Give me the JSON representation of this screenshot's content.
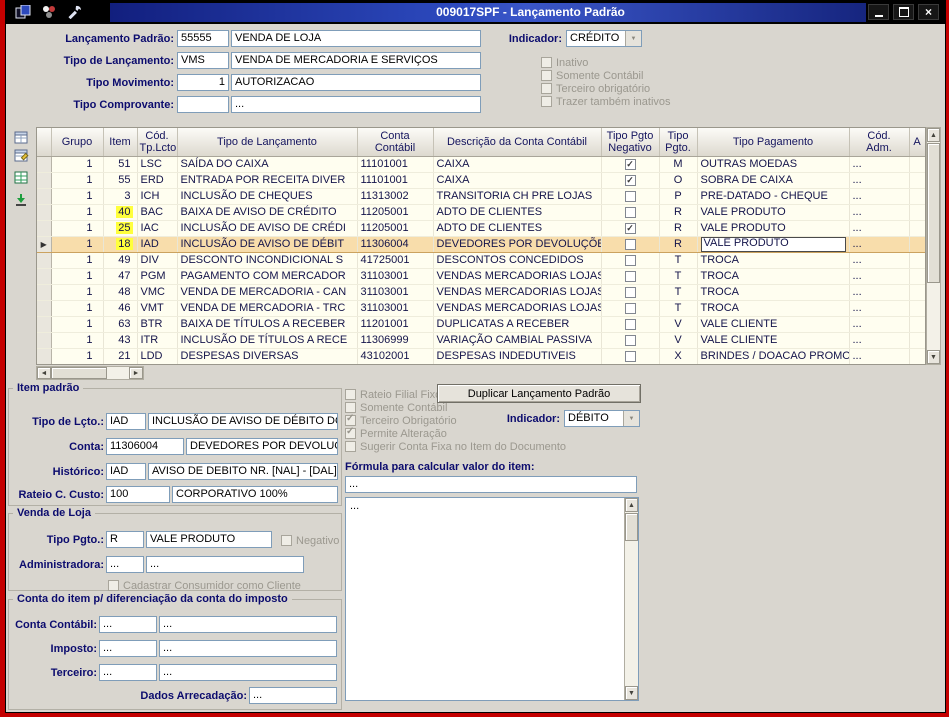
{
  "icons": {
    "dropdown": "▼",
    "check": "✓",
    "up": "▲",
    "down": "▼",
    "left": "◄",
    "right": "►",
    "row_pointer": "▶",
    "close": "×",
    "ellipsis": "..."
  },
  "window": {
    "title": "009017SPF - Lançamento Padrão"
  },
  "form": {
    "lancamento_padrao_label": "Lançamento Padrão:",
    "lancamento_padrao_code": "55555",
    "lancamento_padrao_desc": "VENDA DE LOJA",
    "indicador_label": "Indicador:",
    "indicador_value": "CRÉDITO",
    "tipo_lancamento_label": "Tipo de Lançamento:",
    "tipo_lancamento_code": "VMS",
    "tipo_lancamento_desc": "VENDA DE MERCADORIA E SERVIÇOS",
    "tipo_movimento_label": "Tipo Movimento:",
    "tipo_movimento_code": "1",
    "tipo_movimento_desc": "AUTORIZACAO",
    "tipo_comprovante_label": "Tipo Comprovante:",
    "tipo_comprovante_code": "",
    "tipo_comprovante_desc": "...",
    "options": [
      {
        "label": "Inativo",
        "checked": false
      },
      {
        "label": "Somente Contábil",
        "checked": false
      },
      {
        "label": "Terceiro obrigatório",
        "checked": false
      },
      {
        "label": "Trazer também inativos",
        "checked": false
      }
    ]
  },
  "grid": {
    "columns": [
      "",
      "Grupo",
      "Item",
      "Cód.\nTp.Lcto",
      "Tipo de Lançamento",
      "Conta Contábil",
      "Descrição da Conta Contábil",
      "Tipo Pgto\nNegativo",
      "Tipo\nPgto.",
      "Tipo Pagamento",
      "Cód.\nAdm.",
      "A"
    ],
    "rows": [
      {
        "grupo": "1",
        "item": "51",
        "cod": "LSC",
        "tipo": "SAÍDA DO CAIXA",
        "conta": "11101001",
        "descricao": "CAIXA",
        "negativo": true,
        "pgto": "M",
        "pagamento": "OUTRAS MOEDAS",
        "adm": "...",
        "item_hl": false,
        "selected": false
      },
      {
        "grupo": "1",
        "item": "55",
        "cod": "ERD",
        "tipo": "ENTRADA POR RECEITA DIVER",
        "conta": "11101001",
        "descricao": "CAIXA",
        "negativo": true,
        "pgto": "O",
        "pagamento": "SOBRA DE CAIXA",
        "adm": "...",
        "item_hl": false,
        "selected": false
      },
      {
        "grupo": "1",
        "item": "3",
        "cod": "ICH",
        "tipo": "INCLUSÃO DE CHEQUES",
        "conta": "11313002",
        "descricao": "TRANSITORIA CH PRE LOJAS",
        "negativo": false,
        "pgto": "P",
        "pagamento": "PRE-DATADO - CHEQUE",
        "adm": "...",
        "item_hl": false,
        "selected": false
      },
      {
        "grupo": "1",
        "item": "40",
        "cod": "BAC",
        "tipo": "BAIXA DE AVISO DE CRÉDITO",
        "conta": "11205001",
        "descricao": "ADTO DE CLIENTES",
        "negativo": false,
        "pgto": "R",
        "pagamento": "VALE PRODUTO",
        "adm": "...",
        "item_hl": true,
        "selected": false
      },
      {
        "grupo": "1",
        "item": "25",
        "cod": "IAC",
        "tipo": "INCLUSÃO DE AVISO DE CRÉDI",
        "conta": "11205001",
        "descricao": "ADTO DE CLIENTES",
        "negativo": true,
        "pgto": "R",
        "pagamento": "VALE PRODUTO",
        "adm": "...",
        "item_hl": true,
        "selected": false
      },
      {
        "grupo": "1",
        "item": "18",
        "cod": "IAD",
        "tipo": "INCLUSÃO DE AVISO DE DÉBIT",
        "conta": "11306004",
        "descricao": "DEVEDORES POR DEVOLUÇÕES",
        "negativo": false,
        "pgto": "R",
        "pagamento": "VALE PRODUTO",
        "adm": "...",
        "item_hl": true,
        "selected": true
      },
      {
        "grupo": "1",
        "item": "49",
        "cod": "DIV",
        "tipo": "DESCONTO INCONDICIONAL S",
        "conta": "41725001",
        "descricao": "DESCONTOS CONCEDIDOS",
        "negativo": false,
        "pgto": "T",
        "pagamento": "TROCA",
        "adm": "...",
        "item_hl": false,
        "selected": false
      },
      {
        "grupo": "1",
        "item": "47",
        "cod": "PGM",
        "tipo": "PAGAMENTO COM MERCADOR",
        "conta": "31103001",
        "descricao": "VENDAS MERCADORIAS LOJAS",
        "negativo": false,
        "pgto": "T",
        "pagamento": "TROCA",
        "adm": "...",
        "item_hl": false,
        "selected": false
      },
      {
        "grupo": "1",
        "item": "48",
        "cod": "VMC",
        "tipo": "VENDA DE MERCADORIA - CAN",
        "conta": "31103001",
        "descricao": "VENDAS MERCADORIAS LOJAS",
        "negativo": false,
        "pgto": "T",
        "pagamento": "TROCA",
        "adm": "...",
        "item_hl": false,
        "selected": false
      },
      {
        "grupo": "1",
        "item": "46",
        "cod": "VMT",
        "tipo": "VENDA DE MERCADORIA - TRC",
        "conta": "31103001",
        "descricao": "VENDAS MERCADORIAS LOJAS",
        "negativo": false,
        "pgto": "T",
        "pagamento": "TROCA",
        "adm": "...",
        "item_hl": false,
        "selected": false
      },
      {
        "grupo": "1",
        "item": "63",
        "cod": "BTR",
        "tipo": "BAIXA DE TÍTULOS A RECEBER",
        "conta": "11201001",
        "descricao": "DUPLICATAS A RECEBER",
        "negativo": false,
        "pgto": "V",
        "pagamento": "VALE CLIENTE",
        "adm": "...",
        "item_hl": false,
        "selected": false
      },
      {
        "grupo": "1",
        "item": "43",
        "cod": "ITR",
        "tipo": "INCLUSÃO DE TÍTULOS A RECE",
        "conta": "11306999",
        "descricao": "VARIAÇÃO CAMBIAL PASSIVA",
        "negativo": false,
        "pgto": "V",
        "pagamento": "VALE CLIENTE",
        "adm": "...",
        "item_hl": false,
        "selected": false
      },
      {
        "grupo": "1",
        "item": "21",
        "cod": "LDD",
        "tipo": "DESPESAS DIVERSAS",
        "conta": "43102001",
        "descricao": "DESPESAS INDEDUTIVEIS",
        "negativo": false,
        "pgto": "X",
        "pagamento": "BRINDES / DOACAO PROMOCI...",
        "adm": "...",
        "item_hl": false,
        "selected": false
      }
    ]
  },
  "item_padrao": {
    "title": "Item padrão",
    "tipo_lcto_label": "Tipo de Lçto.:",
    "tipo_lcto_code": "IAD",
    "tipo_lcto_desc": "INCLUSÃO DE AVISO DE DÉBITO DO TE",
    "conta_label": "Conta:",
    "conta_code": "11306004",
    "conta_desc": "DEVEDORES POR DEVOLUÇÕES",
    "historico_label": "Histórico:",
    "historico_code": "IAD",
    "historico_desc": "AVISO DE DEBITO NR. [NAL] - [DAL]",
    "rateio_label": "Rateio C. Custo:",
    "rateio_code": "100",
    "rateio_desc": "CORPORATIVO 100%"
  },
  "item_flags": [
    {
      "label": "Rateio Filial Fixo",
      "checked": false
    },
    {
      "label": "Somente Contábil",
      "checked": false
    },
    {
      "label": "Terceiro Obrigatório",
      "checked": true
    },
    {
      "label": "Permite Alteração",
      "checked": true
    },
    {
      "label": "Sugerir Conta Fixa no Item do Documento",
      "checked": false
    }
  ],
  "actions": {
    "duplicar_label": "Duplicar Lançamento Padrão",
    "indicador_label": "Indicador:",
    "indicador_value": "DÉBITO"
  },
  "formula": {
    "label": "Fórmula para calcular valor do item:",
    "line_value": "...",
    "text_value": "..."
  },
  "venda_loja": {
    "title": "Venda de Loja",
    "tipo_pgto_label": "Tipo Pgto.:",
    "tipo_pgto_code": "R",
    "tipo_pgto_desc": "VALE PRODUTO",
    "negativo": {
      "label": "Negativo",
      "checked": false
    },
    "administradora_label": "Administradora:",
    "administradora_code": "...",
    "administradora_desc": "...",
    "cadastrar": {
      "label": "Cadastrar Consumidor como Cliente",
      "checked": false
    }
  },
  "conta_imposto": {
    "title": "Conta do item p/ diferenciação da conta do imposto",
    "conta_contabil_label": "Conta Contábil:",
    "conta_contabil_code": "...",
    "conta_contabil_desc": "...",
    "imposto_label": "Imposto:",
    "imposto_code": "...",
    "imposto_desc": "...",
    "terceiro_label": "Terceiro:",
    "terceiro_code": "...",
    "terceiro_desc": "...",
    "dados_label": "Dados Arrecadação:",
    "dados_value": "..."
  }
}
